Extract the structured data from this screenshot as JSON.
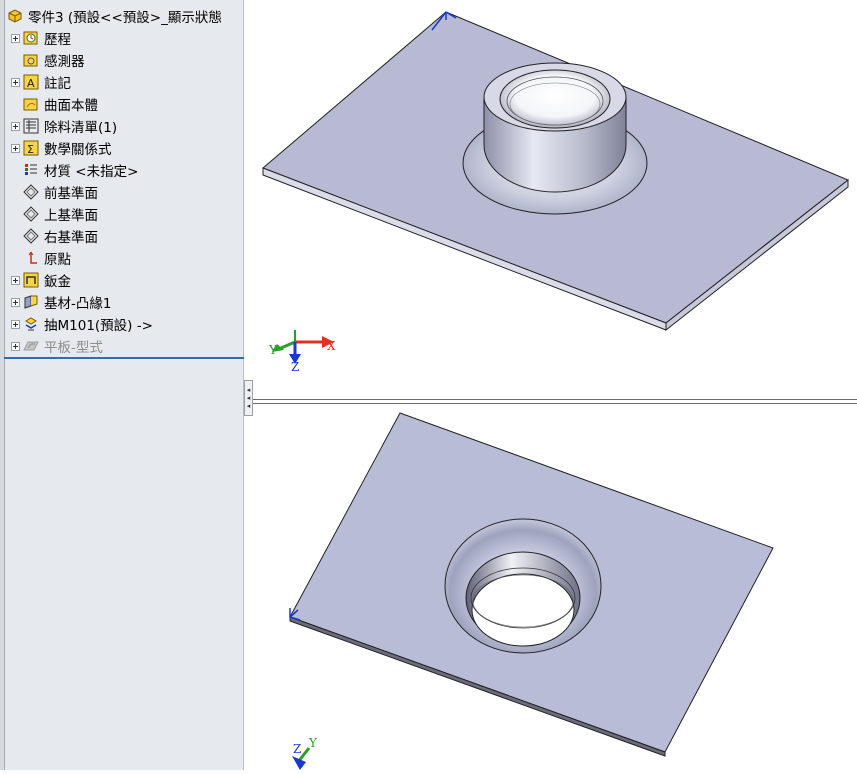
{
  "tree": {
    "root_label": "零件3  (預設<<預設>_顯示狀態",
    "items": [
      {
        "label": "歷程",
        "icon": "history-icon",
        "expandable": true,
        "dim": false
      },
      {
        "label": "感測器",
        "icon": "sensor-icon",
        "expandable": false,
        "dim": false
      },
      {
        "label": "註記",
        "icon": "annotation-icon",
        "expandable": true,
        "dim": false
      },
      {
        "label": "曲面本體",
        "icon": "surface-body-icon",
        "expandable": false,
        "dim": false
      },
      {
        "label": "除料清單(1)",
        "icon": "cut-list-icon",
        "expandable": true,
        "dim": false
      },
      {
        "label": "數學關係式",
        "icon": "equations-icon",
        "expandable": true,
        "dim": false
      },
      {
        "label": "材質 <未指定>",
        "icon": "material-icon",
        "expandable": false,
        "dim": false
      },
      {
        "label": "前基準面",
        "icon": "plane-icon",
        "expandable": false,
        "dim": false
      },
      {
        "label": "上基準面",
        "icon": "plane-icon",
        "expandable": false,
        "dim": false
      },
      {
        "label": "右基準面",
        "icon": "plane-icon",
        "expandable": false,
        "dim": false
      },
      {
        "label": "原點",
        "icon": "origin-icon",
        "expandable": false,
        "dim": false
      },
      {
        "label": "鈑金",
        "icon": "sheet-metal-icon",
        "expandable": true,
        "dim": false
      },
      {
        "label": "基材-凸緣1",
        "icon": "base-flange-icon",
        "expandable": true,
        "dim": false
      },
      {
        "label": "抽M101(預設) ->",
        "icon": "forming-tool-icon",
        "expandable": true,
        "dim": false
      },
      {
        "label": "平板-型式",
        "icon": "flat-pattern-icon",
        "expandable": true,
        "dim": true
      }
    ]
  },
  "viewport_top": {
    "triad": {
      "x_label": "X",
      "y_label": "Y",
      "z_label": "Z"
    }
  },
  "viewport_bottom": {
    "triad": {
      "y_label": "Y",
      "z_label": "Z"
    }
  },
  "colors": {
    "panel_bg": "#e6e9ee",
    "part_face": "#b5b9d2",
    "part_edge": "#1a1a1a",
    "axis_x": "#e03020",
    "axis_y": "#2aa02a",
    "axis_z": "#1838d0"
  }
}
